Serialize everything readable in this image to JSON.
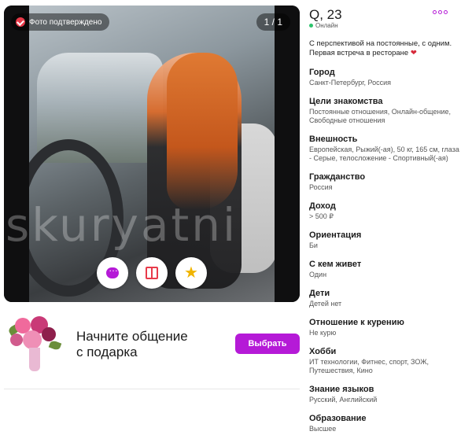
{
  "photo": {
    "verified_label": "Фото подтверждено",
    "counter": "1 / 1",
    "watermark": "skuryatni"
  },
  "actions": [
    {
      "name": "chat",
      "icon": "chat-icon"
    },
    {
      "name": "gift",
      "icon": "gift-icon"
    },
    {
      "name": "favorite",
      "icon": "star-icon"
    }
  ],
  "gift": {
    "text_line1": "Начните общение",
    "text_line2": "с подарка",
    "button": "Выбрать"
  },
  "profile": {
    "name": "Q, 23",
    "status": "Онлайн",
    "bio": "С перспективой на постоянные, с одним. Первая встреча в ресторане",
    "fields": [
      {
        "title": "Город",
        "value": "Санкт-Петербург, Россия"
      },
      {
        "title": "Цели знакомства",
        "value": "Постоянные отношения, Онлайн-общение, Свободные отношения"
      },
      {
        "title": "Внешность",
        "value": "Европейская, Рыжий(-ая), 50 кг, 165 см, глаза - Серые, телосложение - Спортивный(-ая)"
      },
      {
        "title": "Гражданство",
        "value": "Россия"
      },
      {
        "title": "Доход",
        "value": "> 500 ₽"
      },
      {
        "title": "Ориентация",
        "value": "Би"
      },
      {
        "title": "С кем живет",
        "value": "Один"
      },
      {
        "title": "Дети",
        "value": "Детей нет"
      },
      {
        "title": "Отношение к курению",
        "value": "Не курю"
      },
      {
        "title": "Хобби",
        "value": "ИТ технологии, Фитнес, спорт, ЗОЖ, Путешествия, Кино"
      },
      {
        "title": "Знание языков",
        "value": "Русский, Английский"
      },
      {
        "title": "Образование",
        "value": "Высшее"
      }
    ]
  },
  "colors": {
    "accent": "#b51ad7",
    "online": "#2cc36b",
    "verified": "#e83a4a"
  }
}
